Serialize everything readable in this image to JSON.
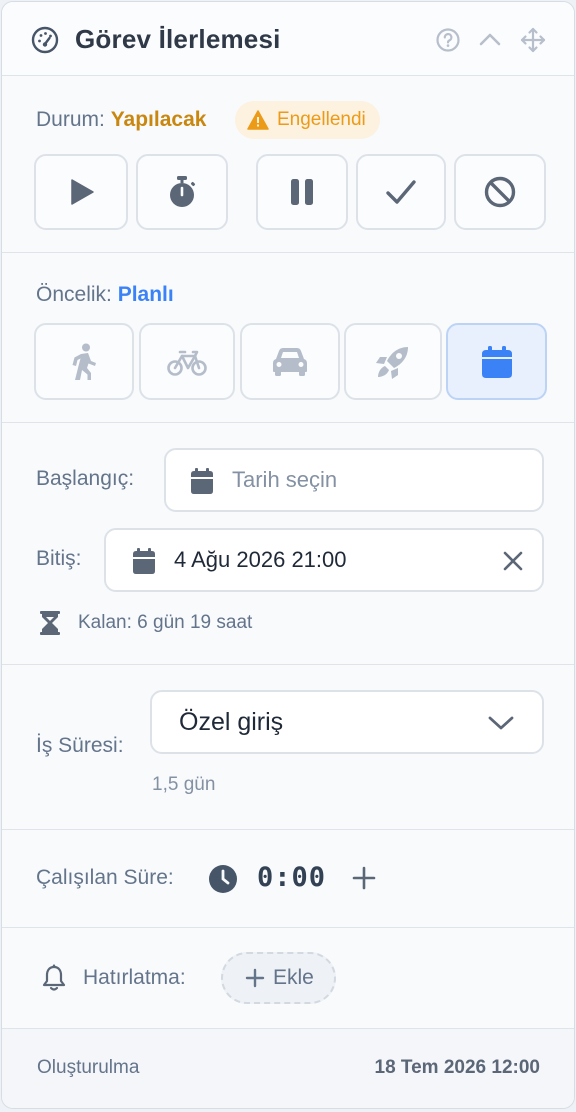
{
  "header": {
    "title": "Görev İlerlemesi",
    "icon": "gauge-icon",
    "tools": [
      "help-icon",
      "chevron-up-icon",
      "move-icon"
    ]
  },
  "status": {
    "label": "Durum:",
    "value": "Yapılacak",
    "badge": "Engellendi",
    "colors": {
      "value": "#c98710",
      "badge_bg": "#fdf1df",
      "badge_text": "#eb9b17"
    },
    "actions": [
      "play-icon",
      "stopwatch-icon",
      "pause-icon",
      "check-icon",
      "block-icon"
    ]
  },
  "priority": {
    "label": "Öncelik:",
    "value": "Planlı",
    "color": "#3b82f6",
    "options": [
      "walking-icon",
      "bicycle-icon",
      "car-icon",
      "rocket-icon",
      "calendar-icon"
    ],
    "selected": "calendar-icon"
  },
  "dates": {
    "start_label": "Başlangıç:",
    "start_placeholder": "Tarih seçin",
    "end_label": "Bitiş:",
    "end_value": "4 Ağu 2026 21:00",
    "remaining": "Kalan: 6 gün 19 saat"
  },
  "duration": {
    "label": "İş Süresi:",
    "selected": "Özel giriş",
    "sub": "1,5 gün"
  },
  "worked": {
    "label": "Çalışılan Süre:",
    "time": "0:00"
  },
  "reminder": {
    "label": "Hatırlatma:",
    "add_label": "Ekle"
  },
  "footer": {
    "created_label": "Oluşturulma",
    "created_value": "18 Tem 2026 12:00"
  }
}
